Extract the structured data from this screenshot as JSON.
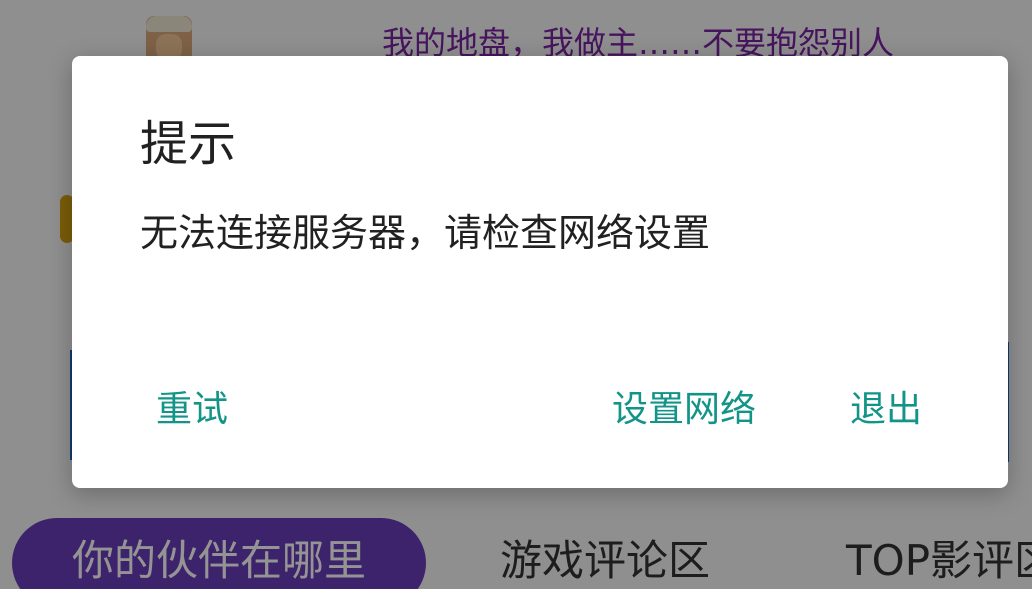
{
  "background": {
    "slogan": "我的地盘，我做主……不要抱怨别人",
    "tabs": [
      {
        "label": "你的伙伴在哪里",
        "active": true
      },
      {
        "label": "游戏评论区",
        "active": false
      },
      {
        "label": "TOP影评区",
        "active": false
      }
    ]
  },
  "dialog": {
    "title": "提示",
    "message": "无法连接服务器，请检查网络设置",
    "buttons": {
      "retry": "重试",
      "settings": "设置网络",
      "exit": "退出"
    }
  },
  "colors": {
    "accent": "#139488",
    "tab_active": "#6a3db8",
    "slogan": "#7b24a3"
  }
}
